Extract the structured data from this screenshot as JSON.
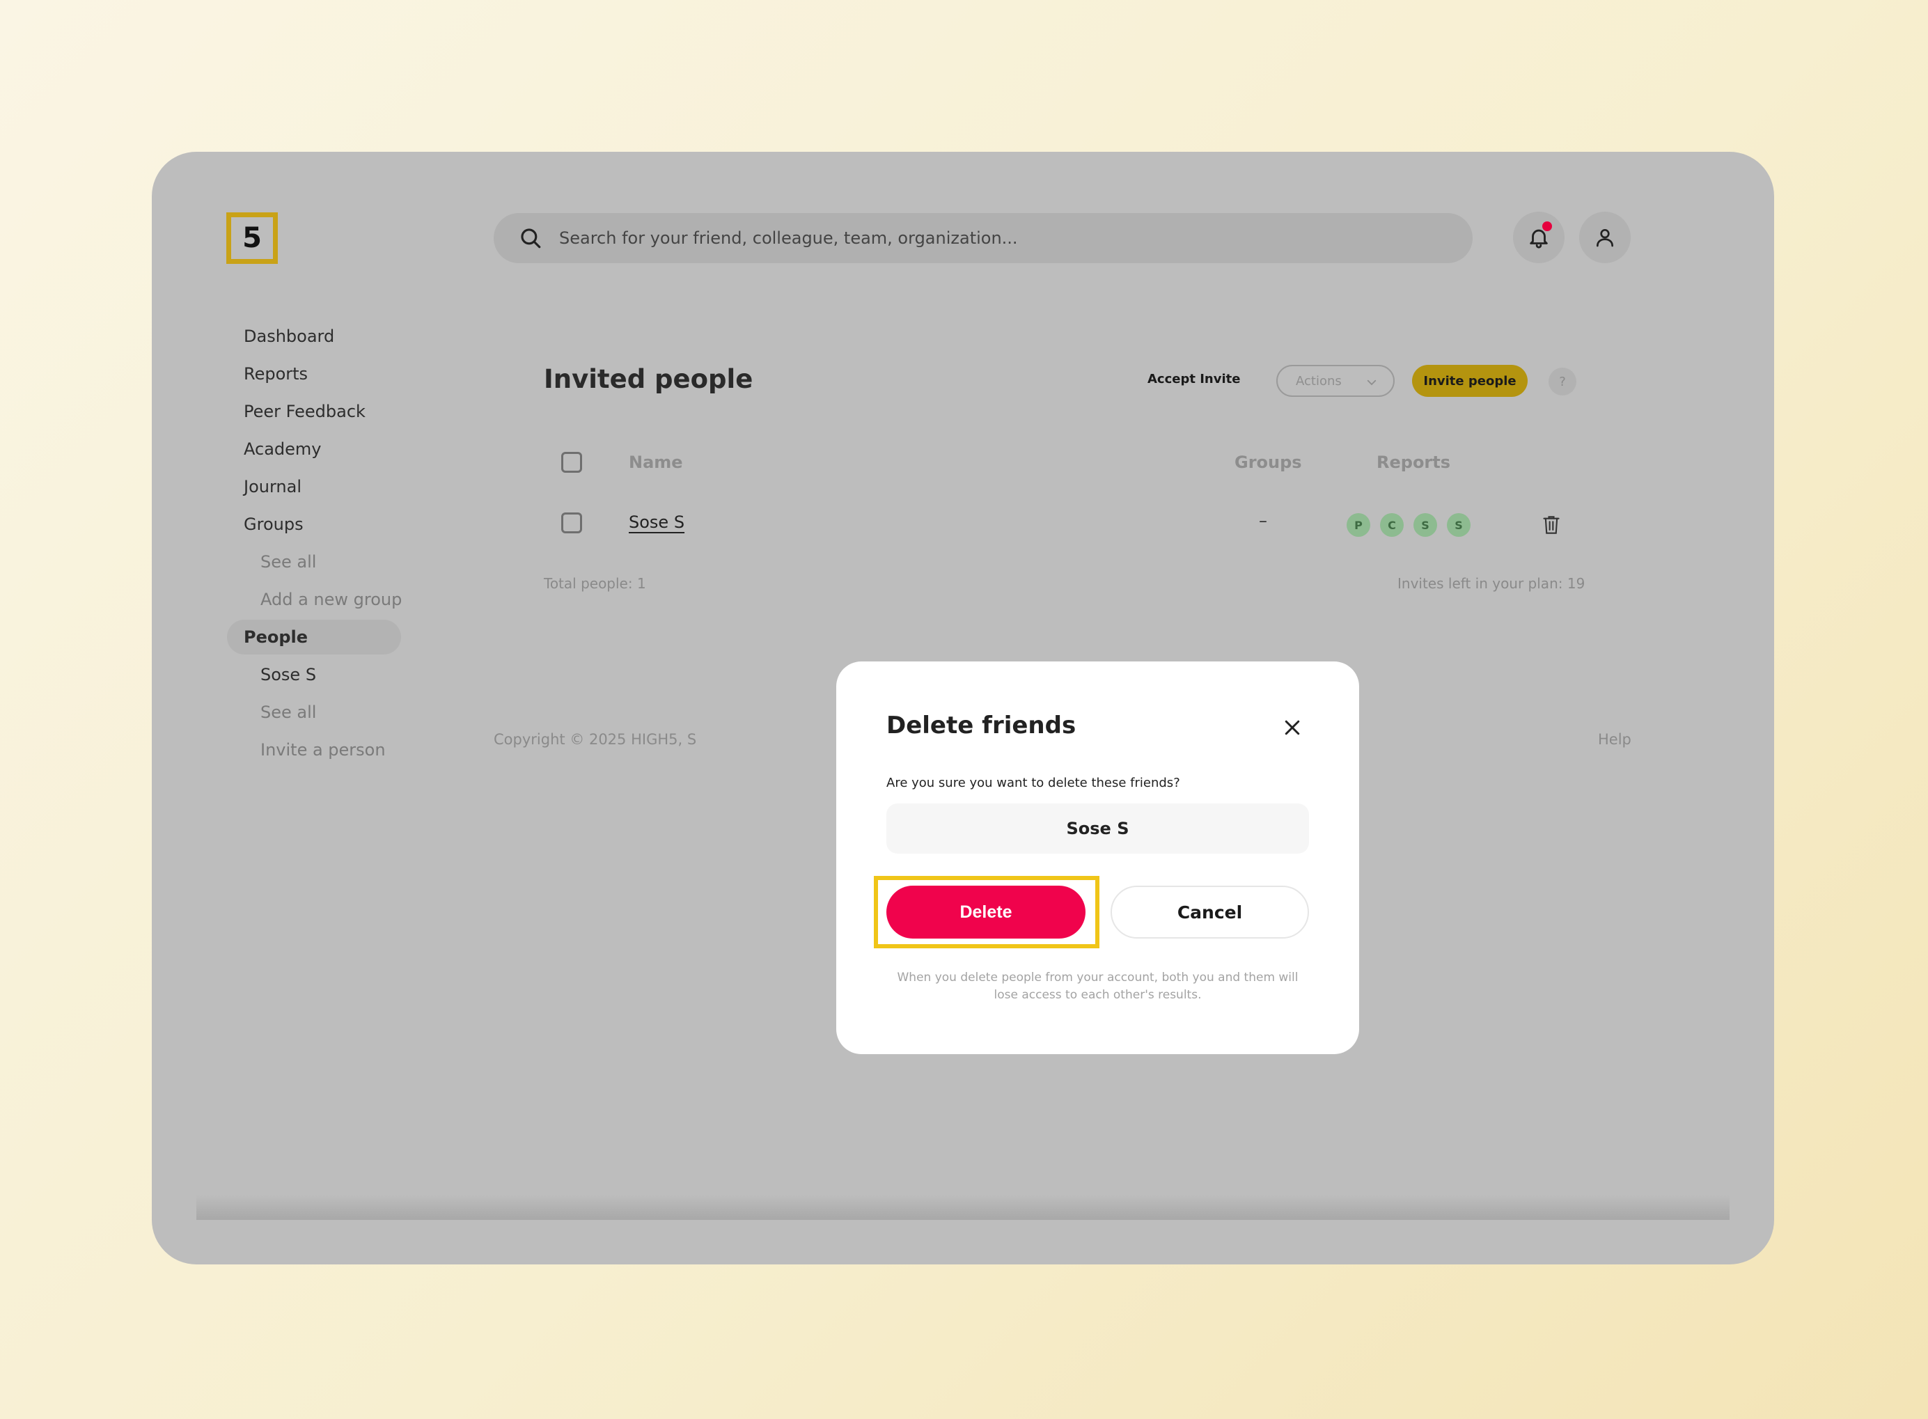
{
  "logo": {
    "text": "5"
  },
  "search": {
    "placeholder": "Search for your friend, colleague, team, organization..."
  },
  "header": {
    "bell_icon": "bell-icon",
    "user_icon": "user-icon",
    "notification_color": "#e6003e"
  },
  "sidebar": {
    "items": [
      {
        "label": "Dashboard"
      },
      {
        "label": "Reports"
      },
      {
        "label": "Peer Feedback"
      },
      {
        "label": "Academy"
      },
      {
        "label": "Journal"
      },
      {
        "label": "Groups"
      },
      {
        "label": "See all"
      },
      {
        "label": "Add a new group"
      },
      {
        "label": "People"
      },
      {
        "label": "Sose S"
      },
      {
        "label": "See all"
      },
      {
        "label": "Invite a person"
      }
    ]
  },
  "main": {
    "title": "Invited people",
    "accept_invite": "Accept Invite",
    "actions_label": "Actions",
    "invite_label": "Invite people",
    "help_label": "?",
    "table": {
      "columns": {
        "name": "Name",
        "groups": "Groups",
        "reports": "Reports"
      },
      "rows": [
        {
          "name": "Sose S",
          "groups": "–",
          "reports": [
            "P",
            "C",
            "S",
            "S"
          ]
        }
      ]
    },
    "total": "Total people: 1",
    "invites_left": "Invites left in your plan: 19"
  },
  "footer": {
    "copyright": "Copyright © 2025 HIGH5, S",
    "help": "Help"
  },
  "modal": {
    "title": "Delete friends",
    "question": "Are you sure you want to delete these friends?",
    "person": "Sose S",
    "delete_label": "Delete",
    "cancel_label": "Cancel",
    "note": "When you delete people from your account, both you and them will lose access to each other's results."
  },
  "colors": {
    "accent": "#c9a217",
    "danger": "#f0034c",
    "highlight": "#f0c518"
  }
}
